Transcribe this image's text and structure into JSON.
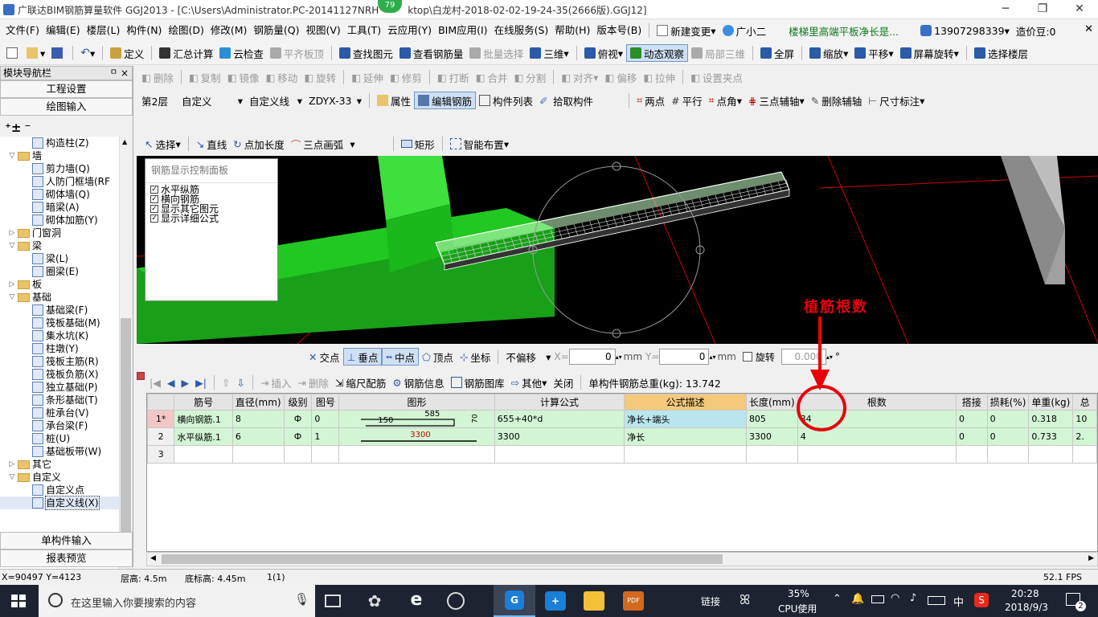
{
  "title": {
    "app": "广联达BIM钢筋算量软件 GGJ2013",
    "path": " - [C:\\Users\\Administrator.PC-20141127NRH",
    "path2": "ktop\\白龙村-2018-02-02-19-24-35(2666版).GGJ12]",
    "badge": "79"
  },
  "menu": [
    "文件(F)",
    "编辑(E)",
    "楼层(L)",
    "构件(N)",
    "绘图(D)",
    "修改(M)",
    "钢筋量(Q)",
    "视图(V)",
    "工具(T)",
    "云应用(Y)",
    "BIM应用(I)",
    "在线服务(S)",
    "帮助(H)",
    "版本号(B)"
  ],
  "menu_right": {
    "new_change": "新建变更",
    "assistant": "广小二",
    "notice": "楼梯里高端平板净长是...",
    "phone": "13907298339",
    "coins": "造价豆:0"
  },
  "toolbar1": [
    {
      "label": "定义",
      "icon": "define-icon"
    },
    {
      "label": "汇总计算",
      "icon": "sigma-icon"
    },
    {
      "label": "云检查",
      "icon": "cloud-check-icon"
    },
    {
      "label": "平齐板顶",
      "icon": "align-top-icon",
      "disabled": true
    },
    {
      "label": "查找图元",
      "icon": "find-icon"
    },
    {
      "label": "查看钢筋量",
      "icon": "view-rebar-icon"
    },
    {
      "label": "批量选择",
      "icon": "batch-select-icon",
      "disabled": true
    },
    {
      "label": "三维",
      "icon": "cube-icon"
    },
    {
      "label": "俯视",
      "icon": "top-view-icon"
    },
    {
      "label": "动态观察",
      "icon": "orbit-icon",
      "active": true
    },
    {
      "label": "局部三维",
      "icon": "local-3d-icon",
      "disabled": true
    },
    {
      "label": "全屏",
      "icon": "fullscreen-icon"
    },
    {
      "label": "缩放",
      "icon": "zoom-icon"
    },
    {
      "label": "平移",
      "icon": "pan-icon"
    },
    {
      "label": "屏幕旋转",
      "icon": "rotate-screen-icon"
    },
    {
      "label": "选择楼层",
      "icon": "select-floor-icon"
    }
  ],
  "toolbar2": [
    "删除",
    "复制",
    "镜像",
    "移动",
    "旋转",
    "延伸",
    "修剪",
    "打断",
    "合并",
    "分割",
    "对齐",
    "偏移",
    "拉伸",
    "设置夹点"
  ],
  "toolbar3": {
    "floor": "第2层",
    "type": "自定义",
    "subtype": "自定义线",
    "name": "ZDYX-33",
    "buttons": [
      "属性",
      "编辑钢筋",
      "构件列表",
      "拾取构件"
    ],
    "aux": [
      "两点",
      "平行",
      "点角",
      "三点辅轴",
      "删除辅轴",
      "尺寸标注"
    ]
  },
  "toolbar4": [
    "选择",
    "直线",
    "点加长度",
    "三点画弧",
    "矩形",
    "智能布置"
  ],
  "nav": {
    "title": "模块导航栏",
    "pin": "ㅁ",
    "close": "×",
    "section1": "工程设置",
    "section2": "绘图输入",
    "section3": "单构件输入",
    "section4": "报表预览"
  },
  "tree": [
    {
      "level": 2,
      "label": "构造柱(Z)",
      "leaf": true
    },
    {
      "level": 1,
      "label": "墙",
      "exp": "−"
    },
    {
      "level": 2,
      "label": "剪力墙(Q)",
      "leaf": true
    },
    {
      "level": 2,
      "label": "人防门框墙(RF",
      "leaf": true
    },
    {
      "level": 2,
      "label": "砌体墙(Q)",
      "leaf": true
    },
    {
      "level": 2,
      "label": "暗梁(A)",
      "leaf": true
    },
    {
      "level": 2,
      "label": "砌体加筋(Y)",
      "leaf": true
    },
    {
      "level": 1,
      "label": "门窗洞",
      "exp": "+"
    },
    {
      "level": 1,
      "label": "梁",
      "exp": "−"
    },
    {
      "level": 2,
      "label": "梁(L)",
      "leaf": true
    },
    {
      "level": 2,
      "label": "圈梁(E)",
      "leaf": true
    },
    {
      "level": 1,
      "label": "板",
      "exp": "+"
    },
    {
      "level": 1,
      "label": "基础",
      "exp": "−"
    },
    {
      "level": 2,
      "label": "基础梁(F)",
      "leaf": true
    },
    {
      "level": 2,
      "label": "筏板基础(M)",
      "leaf": true
    },
    {
      "level": 2,
      "label": "集水坑(K)",
      "leaf": true
    },
    {
      "level": 2,
      "label": "柱墩(Y)",
      "leaf": true
    },
    {
      "level": 2,
      "label": "筏板主筋(R)",
      "leaf": true
    },
    {
      "level": 2,
      "label": "筏板负筋(X)",
      "leaf": true
    },
    {
      "level": 2,
      "label": "独立基础(P)",
      "leaf": true
    },
    {
      "level": 2,
      "label": "条形基础(T)",
      "leaf": true
    },
    {
      "level": 2,
      "label": "桩承台(V)",
      "leaf": true
    },
    {
      "level": 2,
      "label": "承台梁(F)",
      "leaf": true
    },
    {
      "level": 2,
      "label": "桩(U)",
      "leaf": true
    },
    {
      "level": 2,
      "label": "基础板带(W)",
      "leaf": true
    },
    {
      "level": 1,
      "label": "其它",
      "exp": "+"
    },
    {
      "level": 1,
      "label": "自定义",
      "exp": "−"
    },
    {
      "level": 2,
      "label": "自定义点",
      "leaf": true
    },
    {
      "level": 2,
      "label": "自定义线(X)",
      "leaf": true,
      "selected": true
    }
  ],
  "panel": {
    "title": "钢筋显示控制面板",
    "options": [
      "水平纵筋",
      "横向钢筋",
      "显示其它图元",
      "显示详细公式"
    ]
  },
  "annotation": {
    "label": "植筋根数",
    "color": "#e8000b"
  },
  "snap": {
    "items": [
      "交点",
      "垂点",
      "中点",
      "顶点",
      "坐标"
    ],
    "offset": "不偏移",
    "x_label": "X=",
    "x": "0",
    "y_label": "Y=",
    "y": "0",
    "unit": "mm",
    "rotate_label": "旋转",
    "rotate": "0.000",
    "deg": "°"
  },
  "gridtb": {
    "buttons": [
      "插入",
      "删除",
      "缩尺配筋",
      "钢筋信息",
      "钢筋图库",
      "其他",
      "关闭"
    ],
    "total_label": "单构件钢筋总重(kg): 13.742"
  },
  "grid": {
    "columns": [
      "",
      "筋号",
      "直径(mm)",
      "级别",
      "图号",
      "图形",
      "计算公式",
      "公式描述",
      "长度(mm)",
      "根数",
      "搭接",
      "损耗(%)",
      "单重(kg)",
      "总"
    ],
    "rows": [
      {
        "no": "1*",
        "name": "横向钢筋.1",
        "dia": "8",
        "grade": "Ф",
        "fig": "0",
        "shape_a": "150",
        "shape_b": "585",
        "shape_c": "70",
        "formula": "655+40*d",
        "desc": "净长+端头",
        "length": "805",
        "count": "34",
        "lap": "0",
        "loss": "0",
        "unit_w": "0.318",
        "total": "10"
      },
      {
        "no": "2",
        "name": "水平纵筋.1",
        "dia": "6",
        "grade": "Ф",
        "fig": "1",
        "shape_b": "3300",
        "formula": "3300",
        "desc": "净长",
        "length": "3300",
        "count": "4",
        "lap": "0",
        "loss": "0",
        "unit_w": "0.733",
        "total": "2."
      },
      {
        "no": "3"
      }
    ]
  },
  "status": {
    "coords": "X=90497 Y=4123",
    "floor_h": "层高: 4.5m",
    "base_h": "底标高: 4.45m",
    "sel": "1(1)",
    "fps": "52.1 FPS"
  },
  "taskbar": {
    "search": "在这里输入你要搜索的内容",
    "link": "链接",
    "cpu": "35%",
    "cpu_label": "CPU使用",
    "ime": "中",
    "time": "20:28",
    "date": "2018/9/3",
    "notif": "2"
  }
}
